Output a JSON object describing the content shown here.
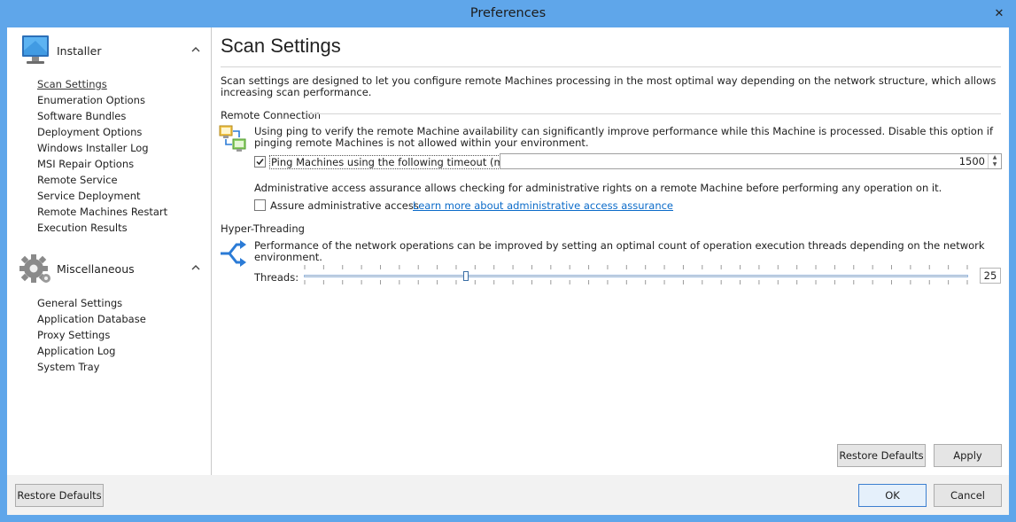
{
  "window": {
    "title": "Preferences",
    "close_glyph": "✕"
  },
  "sidebar": {
    "groups": [
      {
        "title": "Installer",
        "icon": "monitor-icon",
        "items": [
          "Scan Settings",
          "Enumeration Options",
          "Software Bundles",
          "Deployment Options",
          "Windows Installer Log",
          "MSI Repair Options",
          "Remote Service",
          "Service Deployment",
          "Remote Machines Restart",
          "Execution Results"
        ],
        "selected": "Scan Settings"
      },
      {
        "title": "Miscellaneous",
        "icon": "gear-icon",
        "items": [
          "General Settings",
          "Application Database",
          "Proxy Settings",
          "Application Log",
          "System Tray"
        ]
      }
    ]
  },
  "page": {
    "title": "Scan Settings",
    "description": "Scan settings are designed to let you configure remote Machines processing in the most optimal way depending on the network structure, which allows increasing scan performance.",
    "remote_connection": {
      "header": "Remote Connection",
      "ping_text": "Using ping to verify the remote Machine availability can significantly improve performance while this Machine is processed. Disable this option if pinging remote Machines is not allowed within your environment.",
      "ping_label": "Ping Machines using the following timeout (ms.):",
      "ping_checked": true,
      "timeout_value": "1500",
      "admin_text": "Administrative access assurance allows checking for administrative rights on a remote Machine before performing any operation on it.",
      "admin_label": "Assure administrative access",
      "admin_checked": false,
      "admin_link": "Learn more about administrative access assurance"
    },
    "hyper_threading": {
      "header": "Hyper-Threading",
      "text": "Performance of the network operations can be improved by setting an optimal count of operation execution threads depending on the network environment.",
      "threads_label": "Threads:",
      "threads_value": "25"
    },
    "restore_defaults_label": "Restore Defaults",
    "apply_label": "Apply"
  },
  "footer": {
    "restore_defaults_label": "Restore Defaults",
    "ok_label": "OK",
    "cancel_label": "Cancel"
  },
  "colors": {
    "titlebar": "#5fa6ea",
    "link": "#0b6bc9"
  }
}
